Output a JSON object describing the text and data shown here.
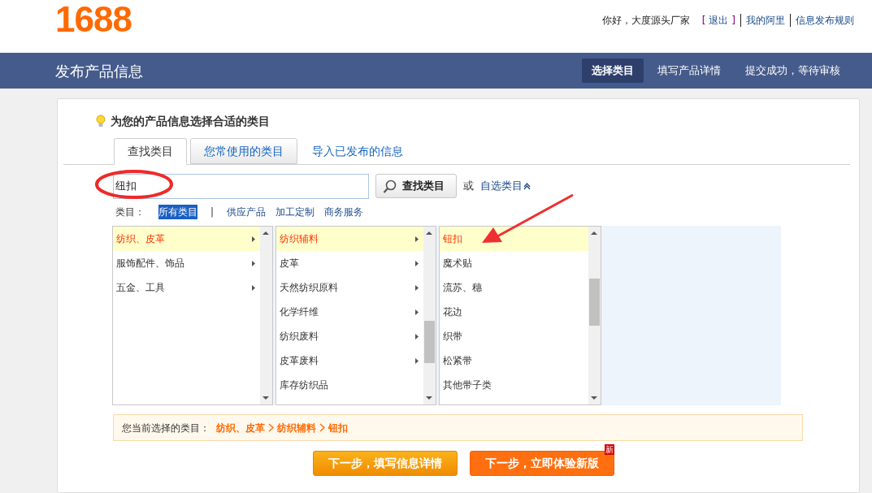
{
  "header": {
    "logo": "1688",
    "greeting": "你好，大度源头厂家",
    "logout": {
      "open": "[",
      "label": "退出",
      "close": "]"
    },
    "links": [
      "我的阿里",
      "信息发布规则"
    ]
  },
  "title_bar": {
    "title": "发布产品信息",
    "steps": [
      {
        "label": "选择类目",
        "selected": true
      },
      {
        "label": "填写产品详情",
        "selected": false
      },
      {
        "label": "提交成功，等待审核",
        "selected": false
      }
    ]
  },
  "hint": "为您的产品信息选择合适的类目",
  "tabs": [
    {
      "kind": "tab",
      "label": "查找类目",
      "selected": true
    },
    {
      "kind": "tab",
      "label": "您常使用的类目",
      "selected": false
    },
    {
      "kind": "link",
      "label": "导入已发布的信息",
      "selected": false
    }
  ],
  "search": {
    "value": "纽扣",
    "button": "查找类目",
    "or": "或",
    "custom": "自选类目"
  },
  "filters": {
    "label": "类目：",
    "items": [
      {
        "kind": "filter",
        "label": "所有类目",
        "selected": true
      },
      {
        "kind": "separator",
        "label": "|"
      },
      {
        "kind": "filter",
        "label": "供应产品",
        "selected": false
      },
      {
        "kind": "filter",
        "label": "加工定制",
        "selected": false
      },
      {
        "kind": "filter",
        "label": "商务服务",
        "selected": false
      }
    ]
  },
  "columns": [
    {
      "items": [
        {
          "label": "纺织、皮革",
          "has_children": true,
          "selected": true
        },
        {
          "label": "服饰配件、饰品",
          "has_children": true,
          "selected": false
        },
        {
          "label": "五金、工具",
          "has_children": true,
          "selected": false
        }
      ]
    },
    {
      "items": [
        {
          "label": "纺织辅料",
          "has_children": true,
          "selected": true
        },
        {
          "label": "皮革",
          "has_children": true,
          "selected": false
        },
        {
          "label": "天然纺织原料",
          "has_children": true,
          "selected": false
        },
        {
          "label": "化学纤维",
          "has_children": true,
          "selected": false
        },
        {
          "label": "纺织废料",
          "has_children": true,
          "selected": false
        },
        {
          "label": "皮革废料",
          "has_children": true,
          "selected": false
        },
        {
          "label": "库存纺织品",
          "has_children": false,
          "selected": false
        }
      ]
    },
    {
      "items": [
        {
          "label": "钮扣",
          "has_children": false,
          "selected": true
        },
        {
          "label": "魔术贴",
          "has_children": false,
          "selected": false
        },
        {
          "label": "流苏、穗",
          "has_children": false,
          "selected": false
        },
        {
          "label": "花边",
          "has_children": false,
          "selected": false
        },
        {
          "label": "织带",
          "has_children": false,
          "selected": false
        },
        {
          "label": "松紧带",
          "has_children": false,
          "selected": false
        },
        {
          "label": "其他带子类",
          "has_children": false,
          "selected": false
        }
      ]
    }
  ],
  "breadcrumb": {
    "label": "您当前选择的类目：",
    "path": [
      "纺织、皮革",
      "纺织辅料",
      "钮扣"
    ]
  },
  "buttons": [
    {
      "kind": "primary",
      "label": "下一步，填写信息详情"
    },
    {
      "kind": "new",
      "label": "下一步，立即体验新版",
      "badge": "新"
    }
  ]
}
